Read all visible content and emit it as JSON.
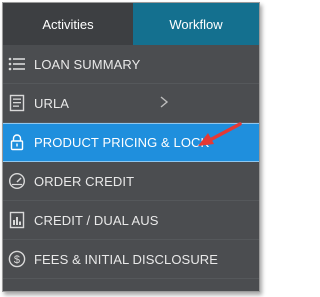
{
  "tabs": [
    {
      "label": "Activities"
    },
    {
      "label": "Workflow"
    }
  ],
  "menu": {
    "items": [
      {
        "label": "LOAN SUMMARY",
        "icon": "list-icon"
      },
      {
        "label": "URLA",
        "icon": "document-icon"
      },
      {
        "label": "PRODUCT PRICING & LOCK",
        "icon": "lock-icon",
        "active": true
      },
      {
        "label": "ORDER CREDIT",
        "icon": "gauge-icon"
      },
      {
        "label": "CREDIT / DUAL AUS",
        "icon": "bar-chart-icon"
      },
      {
        "label": "FEES & INITIAL DISCLOSURE",
        "icon": "dollar-icon"
      }
    ]
  },
  "colors": {
    "panel_bg": "#4b4d50",
    "activities_tab_bg": "#3d3f42",
    "workflow_tab_bg": "#14708f",
    "active_item_bg": "#1f8fdd",
    "annotation_arrow": "#e53935"
  }
}
